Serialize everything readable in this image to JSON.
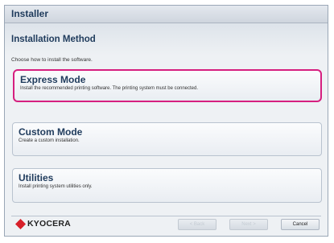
{
  "window": {
    "title": "Installer"
  },
  "page": {
    "heading": "Installation Method",
    "instruction": "Choose how to install the software."
  },
  "options": [
    {
      "title": "Express Mode",
      "description": "Install the recommended printing software. The printing system must be connected.",
      "selected": true
    },
    {
      "title": "Custom Mode",
      "description": "Create a custom installation.",
      "selected": false
    },
    {
      "title": "Utilities",
      "description": "Install printing system utilities only.",
      "selected": false
    }
  ],
  "footer": {
    "brand": "KYOCERA",
    "back_label": "< Back",
    "next_label": "Next >",
    "cancel_label": "Cancel"
  },
  "colors": {
    "accent_selected": "#d61f7f",
    "brand_red": "#d7202a",
    "heading_text": "#1f3b5c"
  }
}
